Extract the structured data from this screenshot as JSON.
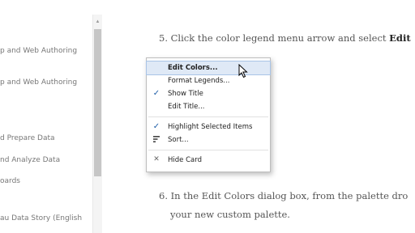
{
  "sidebar": {
    "items": [
      {
        "label": "p and Web Authoring"
      },
      {
        "label": "p and Web Authoring"
      },
      {
        "label": "d Prepare Data"
      },
      {
        "label": "nd Analyze Data"
      },
      {
        "label": "oards"
      },
      {
        "label": "au Data Story (English"
      }
    ]
  },
  "content": {
    "step5_text": "5. Click the color legend menu arrow and select ",
    "step5_bold": "Edit",
    "step6_line1": "6. In the Edit Colors dialog box, from the palette dro",
    "step6_line2": "your new custom palette."
  },
  "context_menu": {
    "items": [
      {
        "label": "Edit Colors...",
        "icon": "",
        "highlighted": true
      },
      {
        "label": "Format Legends...",
        "icon": ""
      },
      {
        "label": "Show Title",
        "icon": "checkmark-icon"
      },
      {
        "label": "Edit Title...",
        "icon": ""
      },
      {
        "label": "Highlight Selected Items",
        "icon": "checkmark-icon"
      },
      {
        "label": "Sort...",
        "icon": "sort-icon"
      },
      {
        "label": "Hide Card",
        "icon": "close-icon"
      }
    ]
  },
  "colors": {
    "highlight": "#dfe9f6",
    "checkmark": "#1f5fa8"
  }
}
